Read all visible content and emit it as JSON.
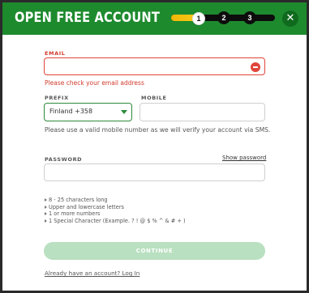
{
  "header": {
    "title": "OPEN FREE ACCOUNT",
    "progress_fraction": 0.25,
    "steps": [
      "1",
      "2",
      "3"
    ],
    "active_step": 1,
    "close_icon": "close-icon"
  },
  "email": {
    "label": "EMAIL",
    "value": "",
    "error_icon": "minus-circle-icon",
    "error_message": "Please check your email address"
  },
  "prefix": {
    "label": "PREFIX",
    "selected": "Finland +358",
    "icon": "chevron-down-icon"
  },
  "mobile": {
    "label": "MOBILE",
    "value": ""
  },
  "mobile_help": "Please use a valid mobile number as we will verify your account via SMS.",
  "password": {
    "label": "PASSWORD",
    "show_label": "Show password",
    "value": ""
  },
  "password_rules": [
    "8 - 25 characters long",
    "Upper and lowercase letters",
    "1 or more numbers",
    "1 Special Character (Example. ? ! @ $ % ^ & # + )"
  ],
  "continue_label": "CONTINUE",
  "login_link": "Already have an account? Log In",
  "colors": {
    "header_green": "#1e8a2e",
    "error_red": "#e0453a",
    "progress_yellow": "#f2b705",
    "button_disabled": "#b9e0c0"
  }
}
